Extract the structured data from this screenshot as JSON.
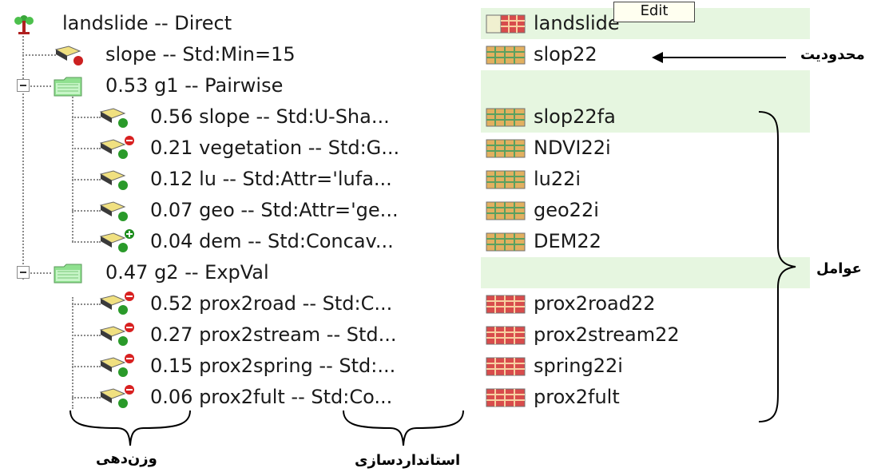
{
  "tooltip": "Edit",
  "rows": [
    {
      "label": "landslide -- Direct",
      "map": "landslide"
    },
    {
      "label": "slope -- Std:Min=15",
      "map": "slop22"
    },
    {
      "label": "0.53 g1 -- Pairwise",
      "map": ""
    },
    {
      "label": "0.56 slope -- Std:U-Sha...",
      "map": "slop22fa"
    },
    {
      "label": "0.21 vegetation -- Std:G...",
      "map": "NDVI22i"
    },
    {
      "label": "0.12 lu -- Std:Attr='lufa...",
      "map": "lu22i"
    },
    {
      "label": "0.07 geo -- Std:Attr='ge...",
      "map": "geo22i"
    },
    {
      "label": "0.04 dem -- Std:Concav...",
      "map": "DEM22"
    },
    {
      "label": "0.47 g2 -- ExpVal",
      "map": ""
    },
    {
      "label": "0.52 prox2road -- Std:C...",
      "map": "prox2road22"
    },
    {
      "label": "0.27 prox2stream -- Std...",
      "map": "prox2stream22"
    },
    {
      "label": "0.15 prox2spring -- Std:...",
      "map": "spring22i"
    },
    {
      "label": "0.06 prox2fult -- Std:Co...",
      "map": "prox2fult"
    }
  ],
  "annotations": {
    "constraint": "محدودیت",
    "factors": "عوامل",
    "weighting": "وزن‌دهی",
    "standardization": "استانداردسازی"
  },
  "colors": {
    "green_band": "#e6f6e0",
    "dotted_line": "#8a8a8a"
  }
}
